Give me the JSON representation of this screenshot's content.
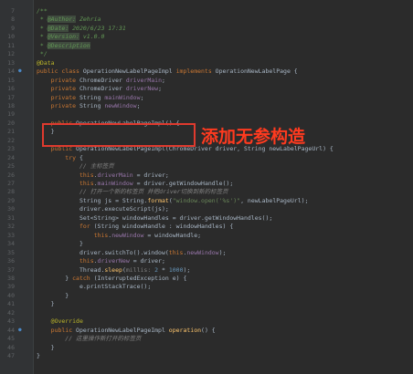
{
  "annotation": {
    "text": "添加无参构造",
    "highlight_color": "#e03a2e"
  },
  "colors": {
    "background": "#2b2b2b",
    "gutter": "#313335"
  },
  "lines": [
    {
      "n": "7",
      "gi": "",
      "t": [
        [
          "/**",
          "cm"
        ]
      ]
    },
    {
      "n": "8",
      "gi": "",
      "t": [
        [
          " * ",
          "cm"
        ],
        [
          "@Author:",
          "tg"
        ],
        [
          " Zehria",
          "cm"
        ]
      ]
    },
    {
      "n": "9",
      "gi": "",
      "t": [
        [
          " * ",
          "cm"
        ],
        [
          "@Date:",
          "tg"
        ],
        [
          " 2020/6/23 17:31",
          "cm"
        ]
      ]
    },
    {
      "n": "10",
      "gi": "",
      "t": [
        [
          " * ",
          "cm"
        ],
        [
          "@Version:",
          "tg"
        ],
        [
          " v1.0.0",
          "cm"
        ]
      ]
    },
    {
      "n": "11",
      "gi": "",
      "t": [
        [
          " * ",
          "cm"
        ],
        [
          "@Description",
          "tg"
        ]
      ]
    },
    {
      "n": "12",
      "gi": "",
      "t": [
        [
          " */",
          "cm"
        ]
      ]
    },
    {
      "n": "13",
      "gi": "",
      "t": [
        [
          "@Data",
          "an"
        ]
      ]
    },
    {
      "n": "14",
      "gi": "●",
      "t": [
        [
          "public class ",
          "kw"
        ],
        [
          "OperationNewLabelPageImpl ",
          ""
        ],
        [
          "implements ",
          "kw"
        ],
        [
          "OperationNewLabelPage {",
          ""
        ]
      ]
    },
    {
      "n": "15",
      "gi": "",
      "t": [
        [
          "    private ",
          "kw"
        ],
        [
          "ChromeDriver ",
          ""
        ],
        [
          "driverMain",
          "fd"
        ],
        [
          ";",
          ""
        ]
      ]
    },
    {
      "n": "16",
      "gi": "",
      "t": [
        [
          "    private ",
          "kw"
        ],
        [
          "ChromeDriver ",
          ""
        ],
        [
          "driverNew",
          "fd"
        ],
        [
          ";",
          ""
        ]
      ]
    },
    {
      "n": "17",
      "gi": "",
      "t": [
        [
          "    private ",
          "kw"
        ],
        [
          "String ",
          ""
        ],
        [
          "mainWindow",
          "fd"
        ],
        [
          ";",
          ""
        ]
      ]
    },
    {
      "n": "18",
      "gi": "",
      "t": [
        [
          "    private ",
          "kw"
        ],
        [
          "String ",
          ""
        ],
        [
          "newWindow",
          "fd"
        ],
        [
          ";",
          ""
        ]
      ]
    },
    {
      "n": "19",
      "gi": "",
      "t": [
        [
          "",
          ""
        ]
      ]
    },
    {
      "n": "20",
      "gi": "",
      "t": [
        [
          "    public ",
          "kw"
        ],
        [
          "OperationNewLabelPageImpl",
          ""
        ],
        [
          "() {",
          ""
        ]
      ]
    },
    {
      "n": "21",
      "gi": "",
      "t": [
        [
          "    }",
          ""
        ]
      ]
    },
    {
      "n": "22",
      "gi": "",
      "t": [
        [
          "",
          ""
        ]
      ]
    },
    {
      "n": "23",
      "gi": "",
      "t": [
        [
          "    public ",
          "kw"
        ],
        [
          "OperationNewLabelPageImpl",
          ""
        ],
        [
          "(ChromeDriver driver, String newLabelPageUrl) {",
          ""
        ]
      ]
    },
    {
      "n": "24",
      "gi": "",
      "t": [
        [
          "        try ",
          "kw"
        ],
        [
          "{",
          ""
        ]
      ]
    },
    {
      "n": "25",
      "gi": "",
      "t": [
        [
          "            // 主标签页",
          "lc"
        ]
      ]
    },
    {
      "n": "26",
      "gi": "",
      "t": [
        [
          "            this",
          "kw"
        ],
        [
          ".",
          ""
        ],
        [
          "driverMain",
          "fd"
        ],
        [
          " = driver;",
          ""
        ]
      ]
    },
    {
      "n": "27",
      "gi": "",
      "t": [
        [
          "            this",
          "kw"
        ],
        [
          ".",
          ""
        ],
        [
          "mainWindow",
          "fd"
        ],
        [
          " = driver.getWindowHandle();",
          ""
        ]
      ]
    },
    {
      "n": "28",
      "gi": "",
      "t": [
        [
          "            // 打开一个新的标签页 并把driver切换到新的标签页",
          "lc"
        ]
      ]
    },
    {
      "n": "29",
      "gi": "",
      "t": [
        [
          "            String js = String.",
          ""
        ],
        [
          "format",
          "fn"
        ],
        [
          "(",
          ""
        ],
        [
          "\"window.open('%s')\"",
          "st"
        ],
        [
          ", newLabelPageUrl);",
          ""
        ]
      ]
    },
    {
      "n": "30",
      "gi": "",
      "t": [
        [
          "            driver.executeScript(js);",
          ""
        ]
      ]
    },
    {
      "n": "31",
      "gi": "",
      "t": [
        [
          "            Set<String> windowHandles = driver.getWindowHandles();",
          ""
        ]
      ]
    },
    {
      "n": "32",
      "gi": "",
      "t": [
        [
          "            for ",
          "kw"
        ],
        [
          "(String windowHandle : windowHandles) {",
          ""
        ]
      ]
    },
    {
      "n": "33",
      "gi": "",
      "t": [
        [
          "                this",
          "kw"
        ],
        [
          ".",
          ""
        ],
        [
          "newWindow",
          "fd"
        ],
        [
          " = windowHandle;",
          ""
        ]
      ]
    },
    {
      "n": "34",
      "gi": "",
      "t": [
        [
          "            }",
          ""
        ]
      ]
    },
    {
      "n": "35",
      "gi": "",
      "t": [
        [
          "            driver.switchTo().window(",
          ""
        ],
        [
          "this",
          "kw"
        ],
        [
          ".",
          ""
        ],
        [
          "newWindow",
          "fd"
        ],
        [
          ");",
          ""
        ]
      ]
    },
    {
      "n": "36",
      "gi": "",
      "t": [
        [
          "            this",
          "kw"
        ],
        [
          ".",
          ""
        ],
        [
          "driverNew",
          "fd"
        ],
        [
          " = driver;",
          ""
        ]
      ]
    },
    {
      "n": "37",
      "gi": "",
      "t": [
        [
          "            Thread.",
          ""
        ],
        [
          "sleep",
          "fn"
        ],
        [
          "(",
          ""
        ],
        [
          "millis: ",
          "ph"
        ],
        [
          "2",
          "nm"
        ],
        [
          " * ",
          ""
        ],
        [
          "1000",
          "nm"
        ],
        [
          ");",
          ""
        ]
      ]
    },
    {
      "n": "38",
      "gi": "",
      "t": [
        [
          "        } ",
          ""
        ],
        [
          "catch ",
          "kw"
        ],
        [
          "(InterruptedException e) {",
          ""
        ]
      ]
    },
    {
      "n": "39",
      "gi": "",
      "t": [
        [
          "            e.printStackTrace();",
          ""
        ]
      ]
    },
    {
      "n": "40",
      "gi": "",
      "t": [
        [
          "        }",
          ""
        ]
      ]
    },
    {
      "n": "41",
      "gi": "",
      "t": [
        [
          "    }",
          ""
        ]
      ]
    },
    {
      "n": "42",
      "gi": "",
      "t": [
        [
          "",
          ""
        ]
      ]
    },
    {
      "n": "43",
      "gi": "",
      "t": [
        [
          "    @Override",
          "an"
        ]
      ]
    },
    {
      "n": "44",
      "gi": "●",
      "t": [
        [
          "    public ",
          "kw"
        ],
        [
          "OperationNewLabelPageImpl ",
          ""
        ],
        [
          "operation",
          "fn"
        ],
        [
          "() {",
          ""
        ]
      ]
    },
    {
      "n": "45",
      "gi": "",
      "t": [
        [
          "        // 这里操作新打开的标签页",
          "lc"
        ]
      ]
    },
    {
      "n": "46",
      "gi": "",
      "t": [
        [
          "    }",
          ""
        ]
      ]
    },
    {
      "n": "47",
      "gi": "",
      "t": [
        [
          "}",
          ""
        ]
      ]
    }
  ]
}
